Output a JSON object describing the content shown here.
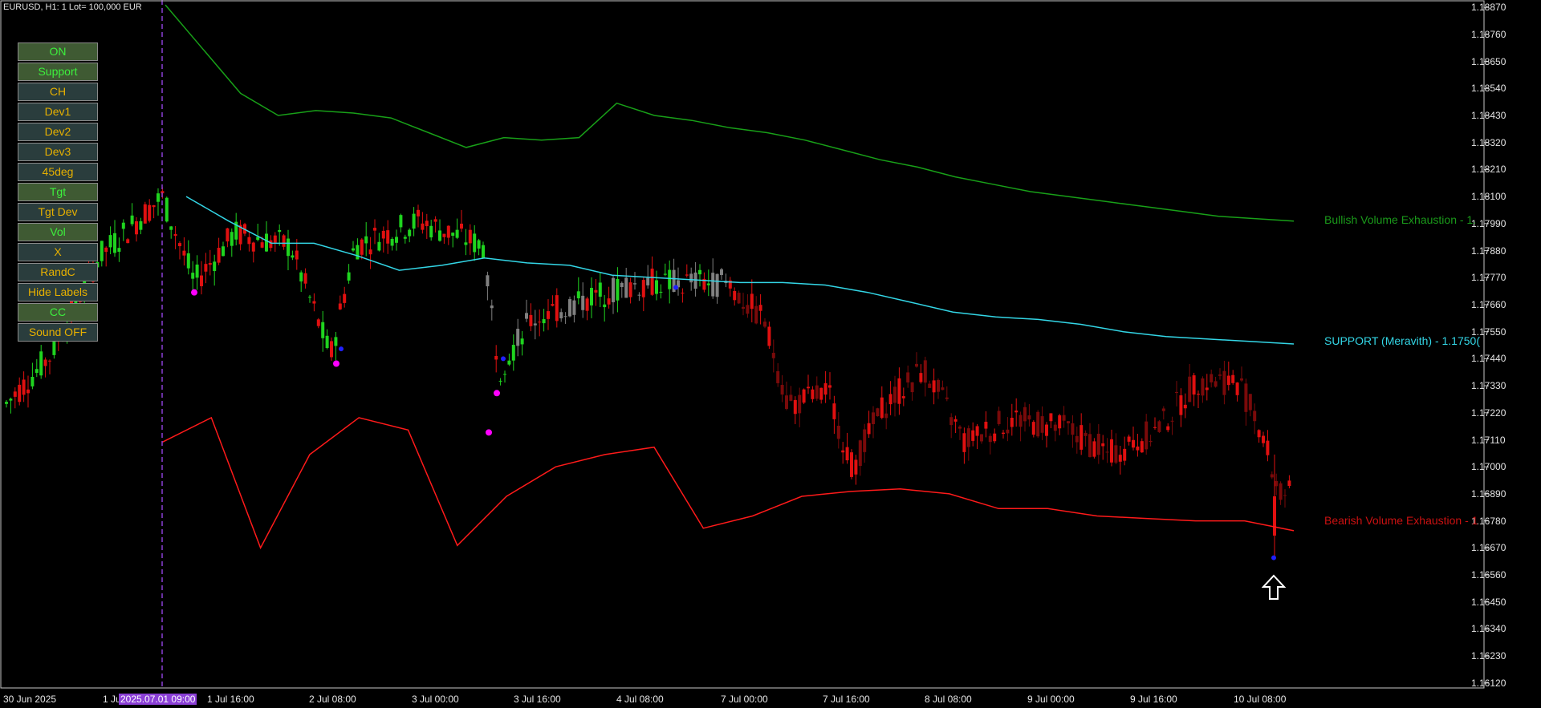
{
  "chart_info": "EURUSD, H1:  1 Lot= 100,000 EUR",
  "panel_buttons": [
    {
      "label": "ON",
      "state": "active"
    },
    {
      "label": "Support",
      "state": "active"
    },
    {
      "label": "CH",
      "state": "inactive"
    },
    {
      "label": "Dev1",
      "state": "inactive"
    },
    {
      "label": "Dev2",
      "state": "inactive"
    },
    {
      "label": "Dev3",
      "state": "inactive"
    },
    {
      "label": "45deg",
      "state": "inactive"
    },
    {
      "label": "Tgt",
      "state": "active"
    },
    {
      "label": "Tgt Dev",
      "state": "inactive"
    },
    {
      "label": "Vol",
      "state": "active"
    },
    {
      "label": "X",
      "state": "inactive"
    },
    {
      "label": "RandC",
      "state": "inactive"
    },
    {
      "label": "Hide Labels",
      "state": "inactive"
    },
    {
      "label": "CC",
      "state": "active"
    },
    {
      "label": "Sound OFF",
      "state": "inactive"
    }
  ],
  "levels": {
    "bullish": {
      "label": "Bullish Volume Exhaustion - 1.",
      "color": "#1a9a1a"
    },
    "support": {
      "label": "SUPPORT (Meravith) - 1.1750(",
      "color": "#33d6e6"
    },
    "bearish": {
      "label": "Bearish Volume Exhaustion - 1",
      "color": "#cc1111"
    }
  },
  "colors": {
    "bull_candle": "#1fd41f",
    "bear_candle": "#e01010",
    "dim_bear_candle": "#7a0a0a",
    "neutral_candle": "#808080",
    "upper_band": "#18a018",
    "support_line": "#33d6e6",
    "lower_band": "#ff1a1a",
    "marker_magenta": "#ff00ff",
    "marker_blue": "#2020ff",
    "vline": "#8b3fd6",
    "axis": "#c8c8c8"
  },
  "chart_data": {
    "type": "candlestick",
    "symbol": "EURUSD",
    "timeframe": "H1",
    "y_ticks": [
      "1.18870",
      "1.18760",
      "1.18650",
      "1.18540",
      "1.18430",
      "1.18320",
      "1.18210",
      "1.18100",
      "1.17990",
      "1.17880",
      "1.17770",
      "1.17660",
      "1.17550",
      "1.17440",
      "1.17330",
      "1.17220",
      "1.17110",
      "1.17000",
      "1.16890",
      "1.16780",
      "1.16670",
      "1.16560",
      "1.16450",
      "1.16340",
      "1.16230",
      "1.16120"
    ],
    "x_ticks": [
      "30 Jun 2025",
      "1 Jul",
      "2025.07.01 09:00",
      "1 Jul 16:00",
      "2 Jul 08:00",
      "3 Jul 00:00",
      "3 Jul 16:00",
      "4 Jul 08:00",
      "7 Jul 00:00",
      "7 Jul 16:00",
      "8 Jul 08:00",
      "9 Jul 00:00",
      "9 Jul 16:00",
      "10 Jul 08:00"
    ],
    "highlighted_x_tick": "2025.07.01 09:00",
    "ylim": [
      1.161,
      1.189
    ],
    "upper_band": [
      1.1888,
      1.187,
      1.1852,
      1.1843,
      1.1845,
      1.1844,
      1.1842,
      1.1836,
      1.183,
      1.1834,
      1.1833,
      1.1834,
      1.1848,
      1.1843,
      1.1841,
      1.1838,
      1.1836,
      1.1833,
      1.1829,
      1.1825,
      1.1822,
      1.1818,
      1.1815,
      1.1812,
      1.181,
      1.1808,
      1.1806,
      1.1804,
      1.1802,
      1.1801,
      1.18
    ],
    "support_line": [
      1.181,
      1.18,
      1.1791,
      1.1791,
      1.1786,
      1.178,
      1.1782,
      1.1785,
      1.1783,
      1.1782,
      1.1778,
      1.1777,
      1.1776,
      1.1775,
      1.1775,
      1.1774,
      1.1771,
      1.1767,
      1.1763,
      1.1761,
      1.176,
      1.1758,
      1.1755,
      1.1753,
      1.1752,
      1.1751,
      1.175
    ],
    "lower_band": [
      1.171,
      1.172,
      1.1667,
      1.1705,
      1.172,
      1.1715,
      1.1668,
      1.1688,
      1.17,
      1.1705,
      1.1708,
      1.1675,
      1.168,
      1.1688,
      1.169,
      1.1691,
      1.1689,
      1.1683,
      1.1683,
      1.168,
      1.1679,
      1.1678,
      1.1678,
      1.1674
    ],
    "candles": [
      {
        "t": "2025.07.01 09:00",
        "o": 1.1812,
        "h": 1.1818,
        "l": 1.18,
        "c": 1.1806
      },
      {
        "t": "10 Jul (last)",
        "o": 1.1688,
        "h": 1.1691,
        "l": 1.1686,
        "c": 1.1689
      }
    ],
    "signal_markers": [
      {
        "color": "magenta",
        "price": 1.1771
      },
      {
        "color": "magenta",
        "price": 1.1742
      },
      {
        "color": "magenta",
        "price": 1.173
      },
      {
        "color": "magenta",
        "price": 1.1714
      },
      {
        "color": "blue",
        "price": 1.1748
      },
      {
        "color": "blue",
        "price": 1.1744
      },
      {
        "color": "blue",
        "price": 1.1773
      },
      {
        "color": "blue",
        "price": 1.1663
      }
    ],
    "grid": false
  }
}
